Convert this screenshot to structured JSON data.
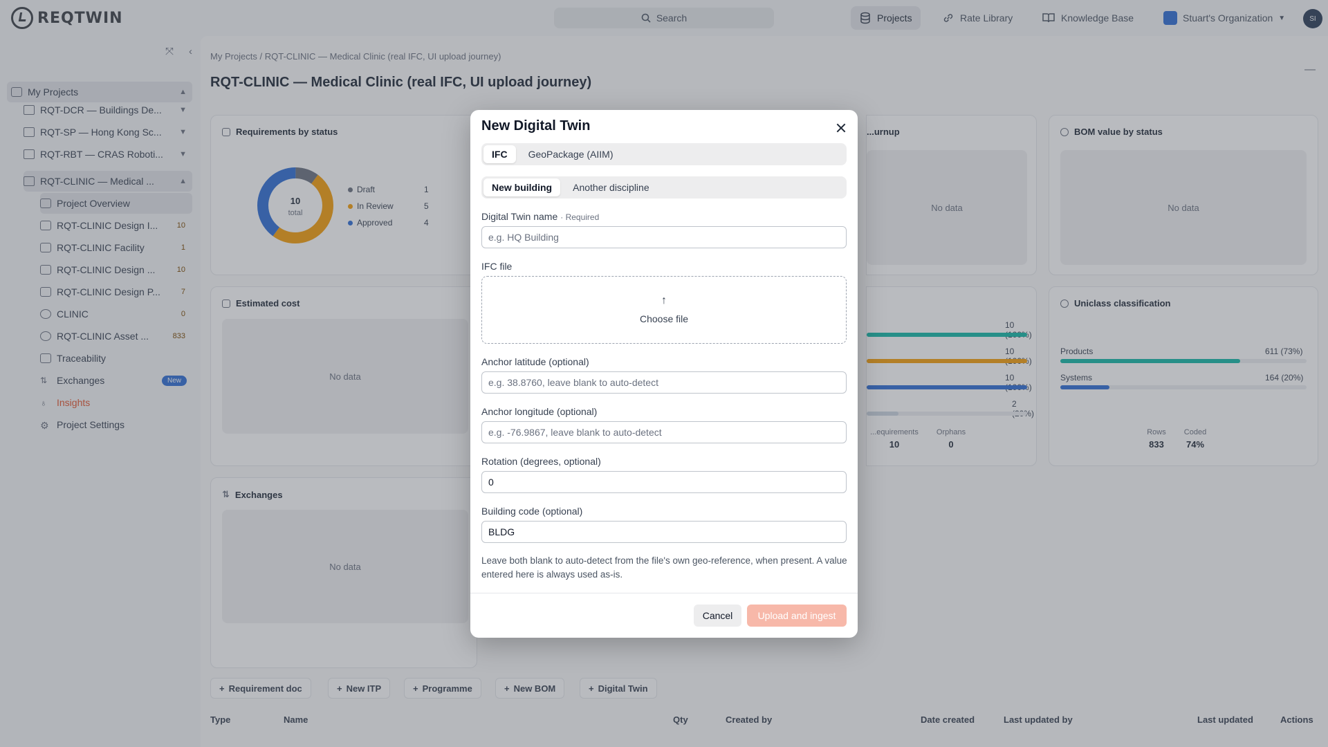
{
  "app": {
    "logo_text": "REQTWIN",
    "user_initials": "SI"
  },
  "topbar": {
    "search_label": "Search",
    "nav": [
      {
        "label": "Projects",
        "icon": "database-icon",
        "active": true
      },
      {
        "label": "Rate Library",
        "icon": "link-icon"
      },
      {
        "label": "Knowledge Base",
        "icon": "book-icon"
      },
      {
        "label": "Stuart's Organization",
        "icon": "org-icon"
      }
    ]
  },
  "sidebar": {
    "root": "My Projects",
    "projects": [
      "RQT-DCR — Buildings De...",
      "RQT-SP — Hong Kong Sc...",
      "RQT-RBT — CRAS Roboti...",
      "RQT-CLINIC — Medical ..."
    ],
    "children": [
      {
        "label": "Project Overview",
        "count": ""
      },
      {
        "label": "RQT-CLINIC Design I...",
        "count": "10"
      },
      {
        "label": "RQT-CLINIC Facility",
        "count": "1"
      },
      {
        "label": "RQT-CLINIC Design ...",
        "count": "10"
      },
      {
        "label": "RQT-CLINIC Design P...",
        "count": "7"
      },
      {
        "label": "CLINIC",
        "count": "0"
      },
      {
        "label": "RQT-CLINIC Asset ...",
        "count": "833"
      },
      {
        "label": "Traceability",
        "count": ""
      },
      {
        "label": "Exchanges",
        "count": "",
        "badge": "New"
      },
      {
        "label": "Insights",
        "count": ""
      },
      {
        "label": "Project Settings",
        "count": ""
      }
    ]
  },
  "main": {
    "breadcrumb": "My Projects / RQT-CLINIC — Medical Clinic (real IFC, UI upload journey)",
    "title": "RQT-CLINIC — Medical Clinic (real IFC, UI upload journey)",
    "cards": {
      "req_status": {
        "title": "Requirements by status",
        "total_value": "10",
        "total_label": "total",
        "legend": [
          {
            "label": "Draft",
            "value": "1",
            "color": "#6b7280"
          },
          {
            "label": "In Review",
            "value": "5",
            "color": "#f59e0b"
          },
          {
            "label": "Approved",
            "value": "4",
            "color": "#2f6fd6"
          }
        ]
      },
      "burnup": {
        "title": "...urnup",
        "nodata": "No data"
      },
      "bom": {
        "title": "BOM value by status",
        "nodata": "No data"
      },
      "cost": {
        "title": "Estimated cost",
        "nodata": "No data"
      },
      "coverage": {
        "bars": [
          {
            "label": "10 (100%)",
            "color": "#14b8a6",
            "pct": 100
          },
          {
            "label": "10 (100%)",
            "color": "#f59e0b",
            "pct": 100
          },
          {
            "label": "10 (100%)",
            "color": "#2f6fd6",
            "pct": 100
          },
          {
            "label": "2 (20%)",
            "color": "#9ca3af",
            "pct": 20
          }
        ],
        "stats": [
          {
            "k": "...equirements",
            "v": "10"
          },
          {
            "k": "Orphans",
            "v": "0"
          }
        ]
      },
      "uniclass": {
        "title": "Uniclass classification",
        "bars": [
          {
            "name": "Products",
            "value": "611 (73%)",
            "pct": 73,
            "color": "#14b8a6"
          },
          {
            "name": "Systems",
            "value": "164 (20%)",
            "pct": 20,
            "color": "#2f6fd6"
          }
        ],
        "stats": [
          {
            "k": "Rows",
            "v": "833"
          },
          {
            "k": "Coded",
            "v": "74%"
          }
        ]
      },
      "exchanges": {
        "title": "Exchanges",
        "nodata": "No data"
      }
    },
    "actions": [
      "Requirement doc",
      "New ITP",
      "Programme",
      "New BOM",
      "Digital Twin"
    ],
    "columns": [
      "Type",
      "Name",
      "Qty",
      "Created by",
      "Date created",
      "Last updated by",
      "Last updated",
      "Actions"
    ]
  },
  "modal": {
    "title": "New Digital Twin",
    "source_tabs": [
      {
        "label": "IFC",
        "active": true
      },
      {
        "label": "GeoPackage (AIIM)",
        "active": false
      }
    ],
    "mode_tabs": [
      {
        "label": "New building",
        "active": true
      },
      {
        "label": "Another discipline",
        "active": false
      }
    ],
    "name_label": "Digital Twin name",
    "required_text": "· Required",
    "name_placeholder": "e.g. HQ Building",
    "file_label": "IFC file",
    "choose_file": "Choose file",
    "lat_label": "Anchor latitude (optional)",
    "lat_placeholder": "e.g. 38.8760, leave blank to auto-detect",
    "lon_label": "Anchor longitude (optional)",
    "lon_placeholder": "e.g. -76.9867, leave blank to auto-detect",
    "rotation_label": "Rotation (degrees, optional)",
    "rotation_value": "0",
    "code_label": "Building code (optional)",
    "code_value": "BLDG",
    "help_text": "Leave both blank to auto-detect from the file's own geo-reference, when present. A value entered here is always used as-is.",
    "cancel": "Cancel",
    "submit": "Upload and ingest"
  }
}
